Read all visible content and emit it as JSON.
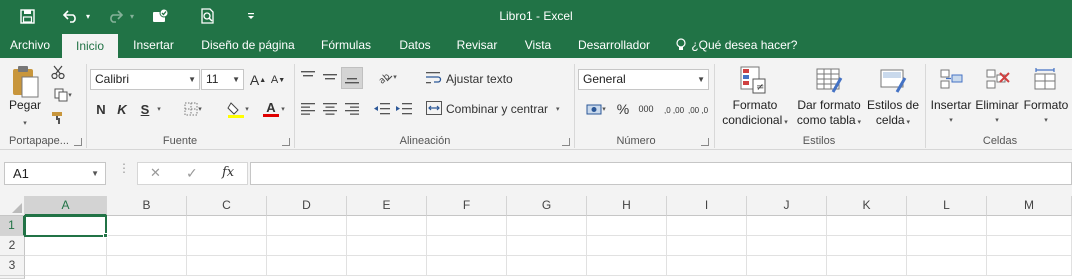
{
  "window": {
    "title": "Libro1 - Excel"
  },
  "qat": {
    "save": "save-icon",
    "undo": "undo-icon",
    "redo": "redo-icon",
    "touch": "touch-mode-icon",
    "preview": "print-preview-icon",
    "customize": "▾"
  },
  "tabs": [
    {
      "label": "Archivo"
    },
    {
      "label": "Inicio"
    },
    {
      "label": "Insertar"
    },
    {
      "label": "Diseño de página"
    },
    {
      "label": "Fórmulas"
    },
    {
      "label": "Datos"
    },
    {
      "label": "Revisar"
    },
    {
      "label": "Vista"
    },
    {
      "label": "Desarrollador"
    },
    {
      "label": "¿Qué desea hacer?"
    }
  ],
  "ribbon": {
    "clipboard": {
      "paste_label": "Pegar",
      "group_label": "Portapape..."
    },
    "font": {
      "name": "Calibri",
      "size": "11",
      "bold": "N",
      "italic": "K",
      "underline": "S",
      "grow": "A",
      "shrink": "A",
      "color_letter": "A",
      "group_label": "Fuente"
    },
    "alignment": {
      "wrap_label": "Ajustar texto",
      "merge_label": "Combinar y centrar",
      "group_label": "Alineación"
    },
    "number": {
      "format": "General",
      "percent": "%",
      "thousands": "000",
      "inc_dec": ",0 ,00",
      "dec_dec": ",00 ,0",
      "group_label": "Número"
    },
    "styles": {
      "cond_line1": "Formato",
      "cond_line2": "condicional",
      "table_line1": "Dar formato",
      "table_line2": "como tabla",
      "cell_line1": "Estilos de",
      "cell_line2": "celda",
      "group_label": "Estilos"
    },
    "cells": {
      "insert": "Insertar",
      "delete": "Eliminar",
      "format": "Formato",
      "group_label": "Celdas"
    }
  },
  "formula_bar": {
    "name_box": "A1",
    "cancel": "✕",
    "enter": "✓",
    "fx": "fx",
    "value": ""
  },
  "grid": {
    "columns": [
      "A",
      "B",
      "C",
      "D",
      "E",
      "F",
      "G",
      "H",
      "I",
      "J",
      "K",
      "L",
      "M"
    ],
    "rows": [
      "1",
      "2",
      "3"
    ],
    "selected_cell": "A1"
  },
  "colors": {
    "brand": "#217346",
    "ribbon_bg": "#f3f3f3"
  }
}
